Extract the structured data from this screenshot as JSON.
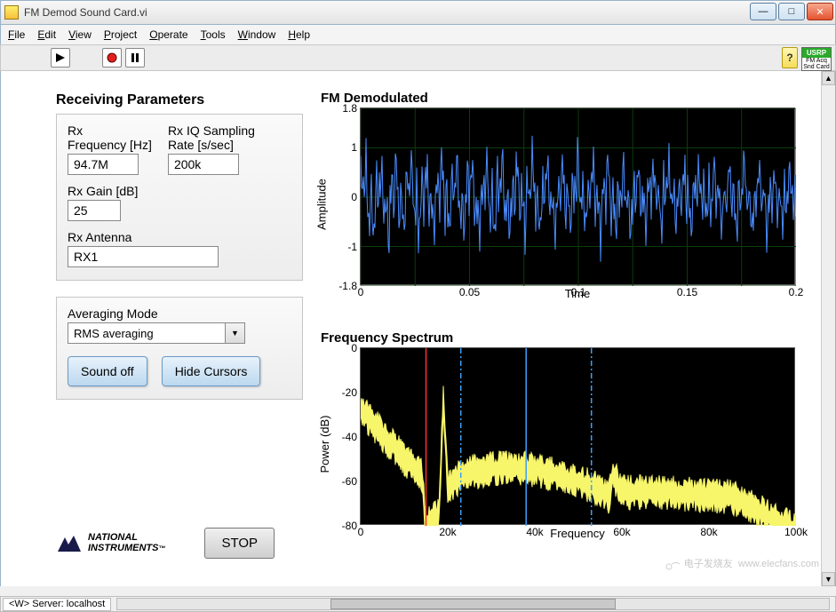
{
  "window": {
    "title": "FM Demod Sound Card.vi",
    "min_tooltip": "Minimize",
    "max_tooltip": "Maximize",
    "close_tooltip": "Close"
  },
  "menu": [
    "File",
    "Edit",
    "View",
    "Project",
    "Operate",
    "Tools",
    "Window",
    "Help"
  ],
  "toolbar": {
    "run": "Run",
    "abort": "Abort",
    "pause": "Pause",
    "help": "?",
    "badge_top": "USRP",
    "badge_l1": "FM Acq",
    "badge_l2": "Snd Card"
  },
  "params": {
    "section_title": "Receiving Parameters",
    "rx_freq_label": "Rx\nFrequency [Hz]",
    "rx_freq_value": "94.7M",
    "rx_iq_label": "Rx IQ Sampling\nRate [s/sec]",
    "rx_iq_value": "200k",
    "rx_gain_label": "Rx Gain [dB]",
    "rx_gain_value": "25",
    "rx_ant_label": "Rx Antenna",
    "rx_ant_value": "RX1"
  },
  "panel2": {
    "avg_label": "Averaging Mode",
    "avg_value": "RMS averaging",
    "sound_btn": "Sound off",
    "cursors_btn": "Hide Cursors"
  },
  "stop_btn": "STOP",
  "logo": {
    "l1": "NATIONAL",
    "l2": "INSTRUMENTS",
    "tm": "™"
  },
  "graphs": {
    "demod_title": "FM Demodulated",
    "demod_ylabel": "Amplitude",
    "demod_xlabel": "Time",
    "spec_title": "Frequency Spectrum",
    "spec_ylabel": "Power (dB)",
    "spec_xlabel": "Frequency"
  },
  "chart_data": [
    {
      "type": "line",
      "title": "FM Demodulated",
      "xlabel": "Time",
      "ylabel": "Amplitude",
      "xlim": [
        0,
        0.2
      ],
      "ylim": [
        -1.8,
        1.8
      ],
      "xticks": [
        0,
        0.05,
        0.1,
        0.15,
        0.2
      ],
      "yticks": [
        -1.8,
        -1,
        0,
        1,
        1.8
      ],
      "series": [
        {
          "name": "demodulated",
          "color": "#4a8cff",
          "note": "dense noisy audio-like waveform oscillating roughly between -1.5 and 1.5 across full time axis; not individually labeled"
        }
      ]
    },
    {
      "type": "line",
      "title": "Frequency Spectrum",
      "xlabel": "Frequency",
      "ylabel": "Power (dB)",
      "xlim": [
        0,
        100000
      ],
      "ylim": [
        -80,
        0
      ],
      "xticks": [
        0,
        20000,
        40000,
        60000,
        80000,
        100000
      ],
      "xtick_labels": [
        "0",
        "20k",
        "40k",
        "60k",
        "80k",
        "100k"
      ],
      "yticks": [
        -80,
        -60,
        -40,
        -20,
        0
      ],
      "series": [
        {
          "name": "power",
          "color": "#f7f56a",
          "x": [
            0,
            2000,
            10000,
            14000,
            15000,
            18000,
            19000,
            20000,
            23000,
            30000,
            38000,
            45000,
            53000,
            57000,
            58000,
            60000,
            70000,
            85000,
            95000,
            100000
          ],
          "values": [
            -25,
            -30,
            -48,
            -55,
            -78,
            -72,
            -20,
            -62,
            -55,
            -52,
            -52,
            -55,
            -60,
            -65,
            -55,
            -63,
            -63,
            -65,
            -75,
            -80
          ]
        }
      ],
      "cursors": [
        {
          "name": "red",
          "x": 15000,
          "color": "#ff2e2e",
          "style": "solid"
        },
        {
          "name": "blue1",
          "x": 23000,
          "color": "#3aa0ff",
          "style": "dashdot"
        },
        {
          "name": "blue2",
          "x": 38000,
          "color": "#3aa0ff",
          "style": "solid"
        },
        {
          "name": "blue3",
          "x": 53000,
          "color": "#3aa0ff",
          "style": "dashdot"
        }
      ]
    }
  ],
  "status": {
    "server": "<W> Server: localhost"
  },
  "watermark": "www.elecfans.com"
}
